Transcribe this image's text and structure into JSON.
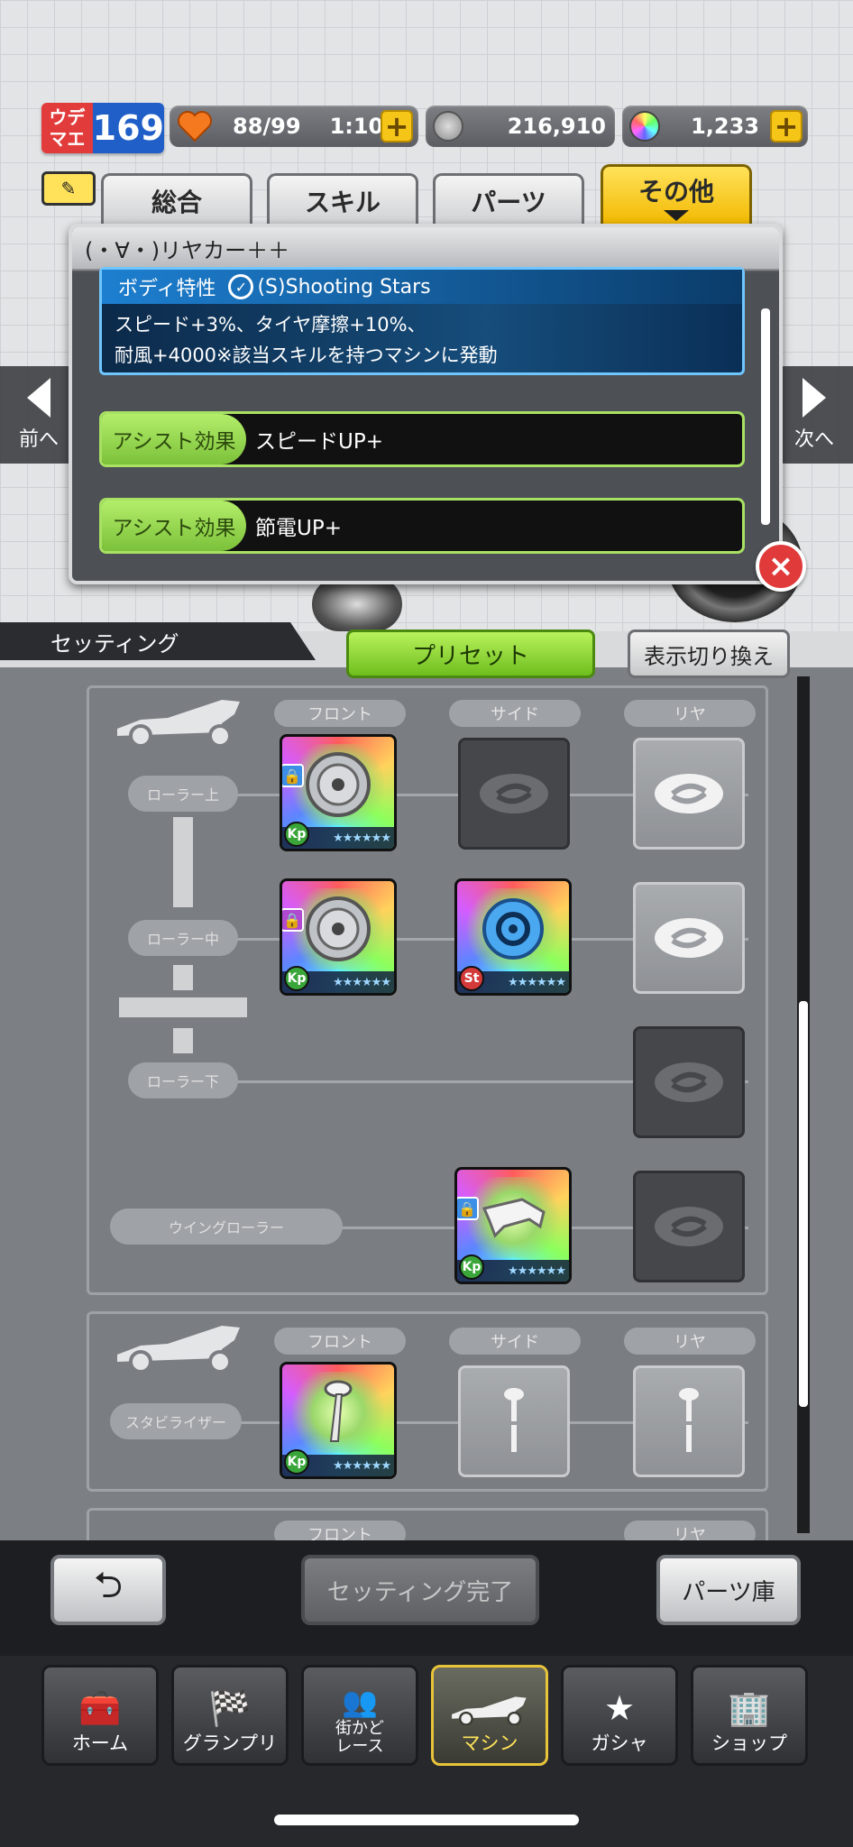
{
  "status": {
    "rank_label": "ウデマエ",
    "rank_value": "169",
    "stamina": "88/99",
    "stamina_timer": "1:10",
    "plus": "+",
    "coins": "216,910",
    "gems": "1,233"
  },
  "tabs": [
    "総合",
    "スキル",
    "パーツ",
    "その他"
  ],
  "sidenav": {
    "prev": "前へ",
    "next": "次へ"
  },
  "popup": {
    "title": "(・∀・)リヤカー＋＋",
    "body_label": "ボディ特性",
    "body_skill": "(S)Shooting Stars",
    "body_desc_1": "スピード+3%、タイヤ摩擦+10%、",
    "body_desc_2": "耐風+4000※該当スキルを持つマシンに発動",
    "assist_label": "アシスト効果",
    "assist_1": "スピードUP+",
    "assist_2": "節電UP+",
    "close": "×"
  },
  "setting": {
    "title": "セッティング",
    "preset": "プリセット",
    "toggle": "表示切り換え"
  },
  "columns": {
    "front": "フロント",
    "side": "サイド",
    "rear": "リヤ"
  },
  "rows": {
    "roller_top": "ローラー上",
    "roller_mid": "ローラー中",
    "roller_bot": "ローラー下",
    "wing_roller": "ウイングローラー",
    "stabilizer": "スタビライザー"
  },
  "badges": {
    "kp": "Kp",
    "st": "St",
    "stars": "★★★★★★"
  },
  "bottom": {
    "back": "⮌",
    "complete": "セッティング完了",
    "parts_storage": "パーツ庫"
  },
  "nav": [
    {
      "label": "ホーム",
      "icon": "toolbox-icon"
    },
    {
      "label": "グランプリ",
      "icon": "checkered-flag-icon"
    },
    {
      "label": "街かど\nレース",
      "icon": "race-people-icon"
    },
    {
      "label": "マシン",
      "icon": "car-icon"
    },
    {
      "label": "ガシャ",
      "icon": "star-laurel-icon"
    },
    {
      "label": "ショップ",
      "icon": "building-icon"
    }
  ],
  "colors": {
    "accent_green": "#a8e163",
    "active_yellow": "#ffe45a",
    "rank_red": "#e23b3b",
    "rank_blue": "#1f5fc7"
  }
}
